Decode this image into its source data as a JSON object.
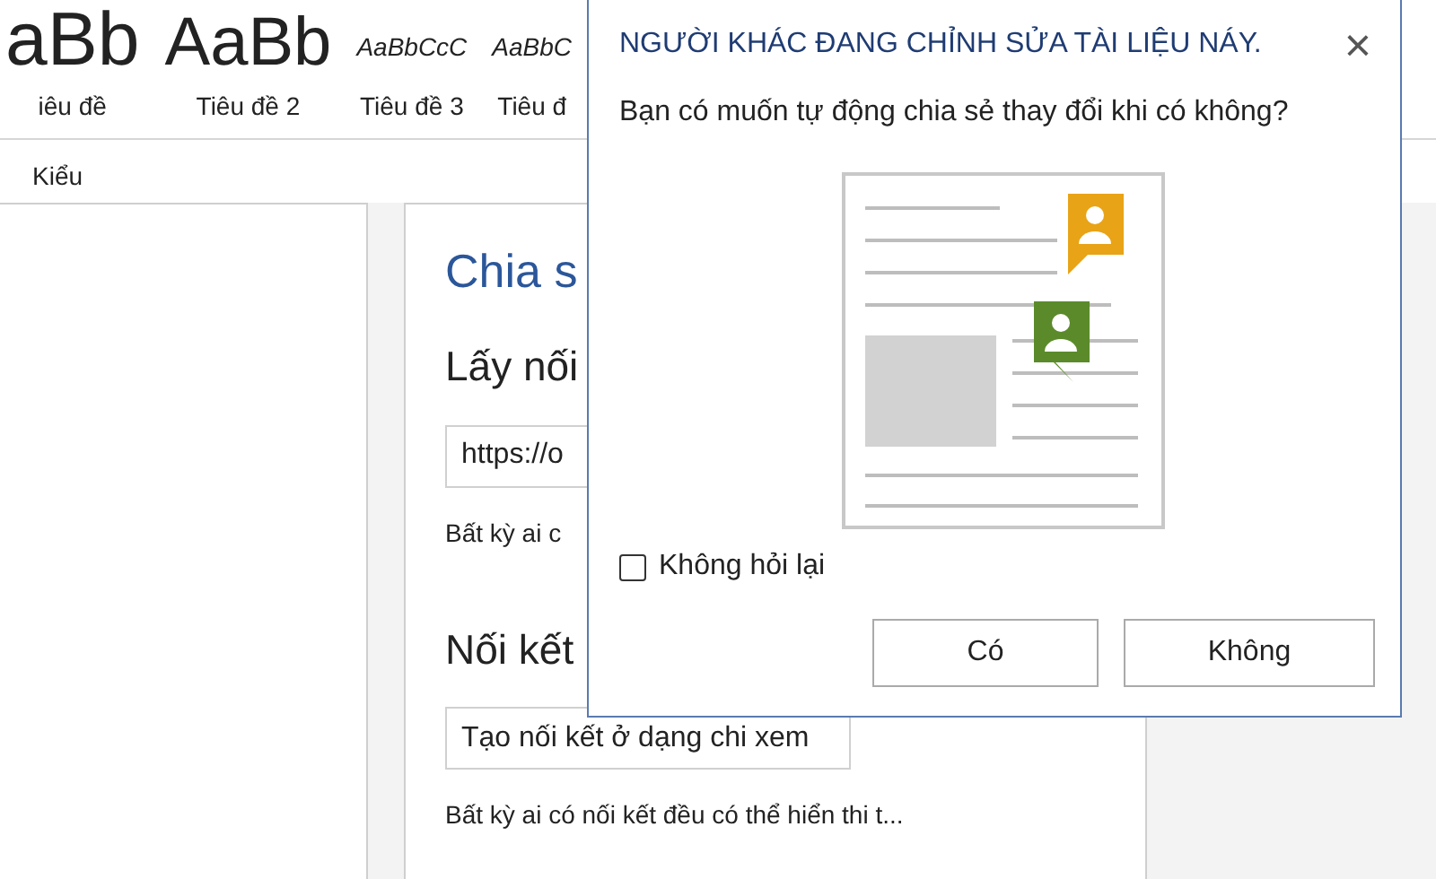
{
  "ribbon": {
    "styles": [
      {
        "sample": "aBb",
        "label": "iêu đề",
        "kind": "heading1"
      },
      {
        "sample": "AaBb",
        "label": "Tiêu đề 2",
        "kind": "heading2"
      },
      {
        "sample": "AaBbCcC",
        "label": "Tiêu đề 3",
        "kind": "heading3"
      },
      {
        "sample": "AaBbC",
        "label": "Tiêu đ",
        "kind": "heading3"
      }
    ],
    "group_label": "Kiểu"
  },
  "share_pane": {
    "title": "Chia s",
    "link_heading": "Lấy nối",
    "link_field": {
      "value": "https://o"
    },
    "link_note": "Bất kỳ ai c",
    "view_heading": "Nối kết",
    "view_field": {
      "value": "Tạo nối kết ở dạng chi xem"
    },
    "view_note": "Bất kỳ ai có nối kết đều có thể hiển thi t..."
  },
  "dialog": {
    "title": "NGƯỜI KHÁC ĐANG CHỈNH SỬA TÀI LIỆU NÁY.",
    "close": "×",
    "message": "Bạn có muốn tự động chia sẻ thay đổi khi có không?",
    "dont_ask": {
      "label": "Không hỏi lại",
      "checked": false
    },
    "buttons": [
      "Có",
      "Không"
    ]
  }
}
